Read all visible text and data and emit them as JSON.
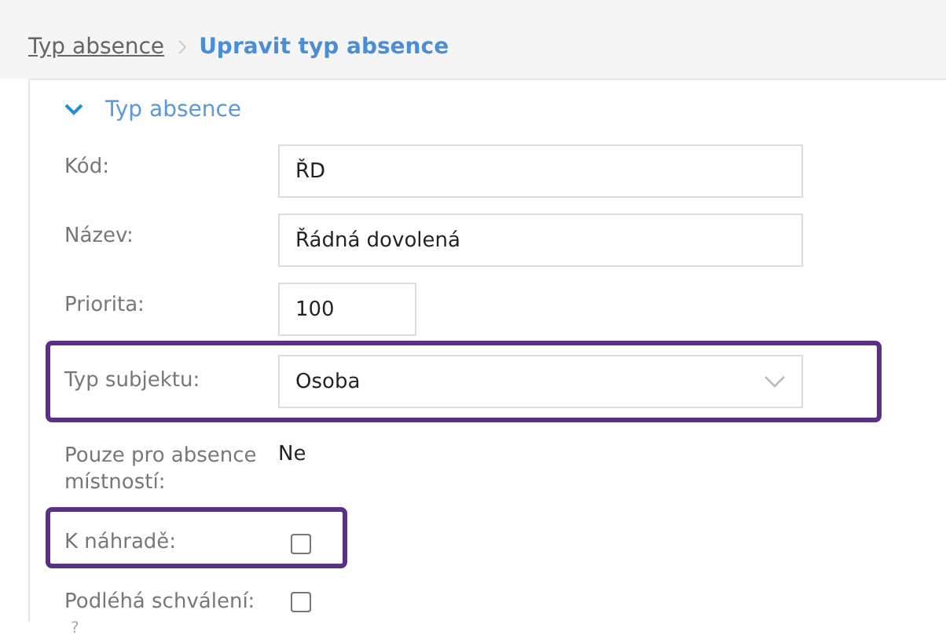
{
  "breadcrumb": [
    {
      "label": "Typ absence",
      "kind": "link"
    },
    {
      "label": "Upravit typ absence",
      "kind": "current"
    }
  ],
  "section": {
    "title": "Typ absence",
    "expanded": true
  },
  "fields": [
    {
      "kind": "input",
      "label": "Kód:",
      "value": "ŘD",
      "highlighted": false
    },
    {
      "kind": "input",
      "label": "Název:",
      "value": "Řádná dovolená",
      "highlighted": false
    },
    {
      "kind": "short-input",
      "label": "Priorita:",
      "value": "100",
      "highlighted": false
    },
    {
      "kind": "select",
      "label": "Typ subjektu:",
      "value": "Osoba",
      "highlighted": true
    },
    {
      "kind": "text",
      "label": "Pouze pro absence místností:",
      "value": "Ne",
      "highlighted": false
    },
    {
      "kind": "checkbox",
      "label": "K náhradě:",
      "checked": false,
      "highlighted": true
    },
    {
      "kind": "checkbox",
      "label": "Podléhá schválení:",
      "checked": false,
      "highlighted": false,
      "help": "?"
    }
  ]
}
